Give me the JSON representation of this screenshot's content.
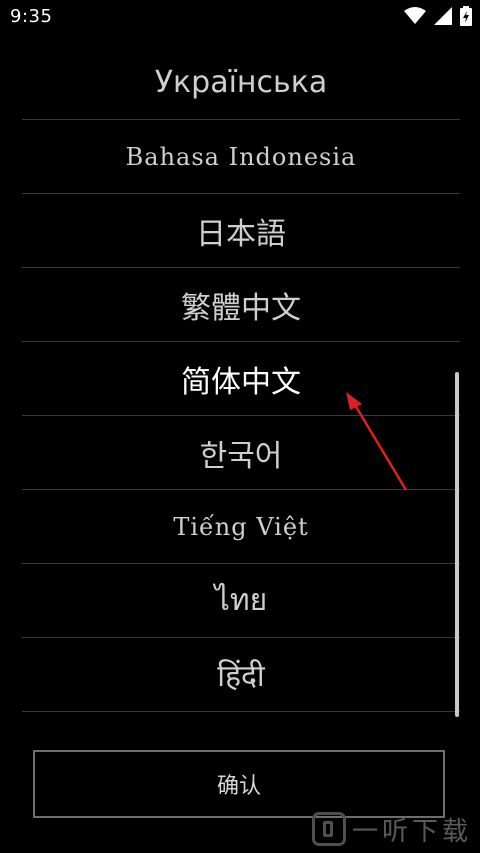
{
  "status_bar": {
    "time": "9:35",
    "icons": [
      "wifi-icon",
      "signal-icon",
      "battery-charging-icon"
    ]
  },
  "languages": [
    {
      "label": "Українська",
      "selected": false
    },
    {
      "label": "Bahasa Indonesia",
      "selected": false
    },
    {
      "label": "日本語",
      "selected": false
    },
    {
      "label": "繁體中文",
      "selected": false
    },
    {
      "label": "简体中文",
      "selected": true
    },
    {
      "label": "한국어",
      "selected": false
    },
    {
      "label": "Tiếng Việt",
      "selected": false
    },
    {
      "label": "ไทย",
      "selected": false
    },
    {
      "label": "हिंदी",
      "selected": false
    }
  ],
  "confirm_label": "确认",
  "annotation_color": "#e0201e",
  "watermark": {
    "text": "一听下载"
  }
}
